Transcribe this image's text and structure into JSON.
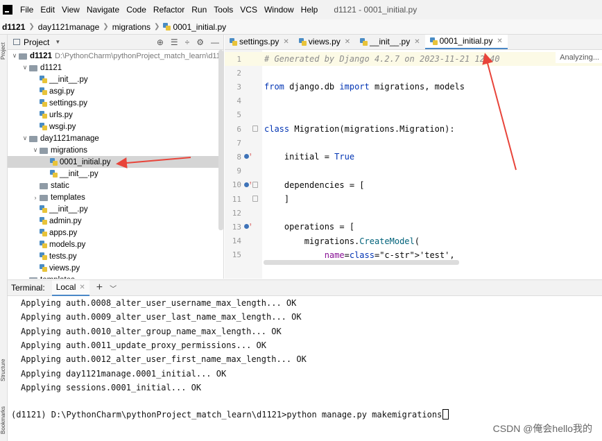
{
  "menu": {
    "items": [
      "File",
      "Edit",
      "View",
      "Navigate",
      "Code",
      "Refactor",
      "Run",
      "Tools",
      "VCS",
      "Window",
      "Help"
    ],
    "window_title": "d1121 - 0001_initial.py"
  },
  "breadcrumb": {
    "root": "d1121",
    "app": "day1121manage",
    "folder": "migrations",
    "file": "0001_initial.py"
  },
  "sidebar_tabs": {
    "project": "Project",
    "structure": "Structure",
    "bookmarks": "Bookmarks"
  },
  "project_panel": {
    "title": "Project",
    "tools": [
      "⊕",
      "☰",
      "÷",
      "⚙",
      "—"
    ],
    "tree": [
      {
        "label": "d1121",
        "path": "D:\\PythonCharm\\pythonProject_match_learn\\d11",
        "indent": 0,
        "arrow": "open",
        "icon": "folder",
        "bold": true
      },
      {
        "label": "d1121",
        "indent": 1,
        "arrow": "open",
        "icon": "folder"
      },
      {
        "label": "__init__.py",
        "indent": 2,
        "icon": "py"
      },
      {
        "label": "asgi.py",
        "indent": 2,
        "icon": "py"
      },
      {
        "label": "settings.py",
        "indent": 2,
        "icon": "py"
      },
      {
        "label": "urls.py",
        "indent": 2,
        "icon": "py"
      },
      {
        "label": "wsgi.py",
        "indent": 2,
        "icon": "py"
      },
      {
        "label": "day1121manage",
        "indent": 1,
        "arrow": "open",
        "icon": "folder"
      },
      {
        "label": "migrations",
        "indent": 2,
        "arrow": "open",
        "icon": "folder"
      },
      {
        "label": "0001_initial.py",
        "indent": 3,
        "icon": "py",
        "selected": true
      },
      {
        "label": "__init__.py",
        "indent": 3,
        "icon": "py"
      },
      {
        "label": "static",
        "indent": 2,
        "icon": "folder"
      },
      {
        "label": "templates",
        "indent": 2,
        "arrow": "closed",
        "icon": "folder"
      },
      {
        "label": "__init__.py",
        "indent": 2,
        "icon": "py"
      },
      {
        "label": "admin.py",
        "indent": 2,
        "icon": "py"
      },
      {
        "label": "apps.py",
        "indent": 2,
        "icon": "py"
      },
      {
        "label": "models.py",
        "indent": 2,
        "icon": "py"
      },
      {
        "label": "tests.py",
        "indent": 2,
        "icon": "py"
      },
      {
        "label": "views.py",
        "indent": 2,
        "icon": "py"
      },
      {
        "label": "templates",
        "indent": 1,
        "icon": "folder"
      }
    ]
  },
  "editor": {
    "tabs": [
      {
        "label": "settings.py",
        "active": false
      },
      {
        "label": "views.py",
        "active": false
      },
      {
        "label": "__init__.py",
        "active": false
      },
      {
        "label": "0001_initial.py",
        "active": true
      }
    ],
    "status": "Analyzing...",
    "lines": [
      {
        "n": "1",
        "text": "# Generated by Django 4.2.7 on 2023-11-21 12:40"
      },
      {
        "n": "2",
        "text": ""
      },
      {
        "n": "3",
        "text": "from django.db import migrations, models"
      },
      {
        "n": "4",
        "text": ""
      },
      {
        "n": "5",
        "text": ""
      },
      {
        "n": "6",
        "text": "class Migration(migrations.Migration):"
      },
      {
        "n": "7",
        "text": ""
      },
      {
        "n": "8",
        "text": "    initial = True"
      },
      {
        "n": "9",
        "text": ""
      },
      {
        "n": "10",
        "text": "    dependencies = ["
      },
      {
        "n": "11",
        "text": "    ]"
      },
      {
        "n": "12",
        "text": ""
      },
      {
        "n": "13",
        "text": "    operations = ["
      },
      {
        "n": "14",
        "text": "        migrations.CreateModel("
      },
      {
        "n": "15",
        "text": "            name='test',"
      }
    ]
  },
  "terminal": {
    "label": "Terminal:",
    "tab": "Local",
    "plus": "+",
    "output": [
      "Applying auth.0008_alter_user_username_max_length... OK",
      "Applying auth.0009_alter_user_last_name_max_length... OK",
      "Applying auth.0010_alter_group_name_max_length... OK",
      "Applying auth.0011_update_proxy_permissions... OK",
      "Applying auth.0012_alter_user_first_name_max_length... OK",
      "Applying day1121manage.0001_initial... OK",
      "Applying sessions.0001_initial... OK"
    ],
    "prompt": "(d1121) D:\\PythonCharm\\pythonProject_match_learn\\d1121>python manage.py makemigrations"
  },
  "watermark": "CSDN @俺会hello我的",
  "colors": {
    "annotation_arrow": "#e8443a",
    "tab_accent": "#4a88c7",
    "selection": "#d5d5d5"
  }
}
